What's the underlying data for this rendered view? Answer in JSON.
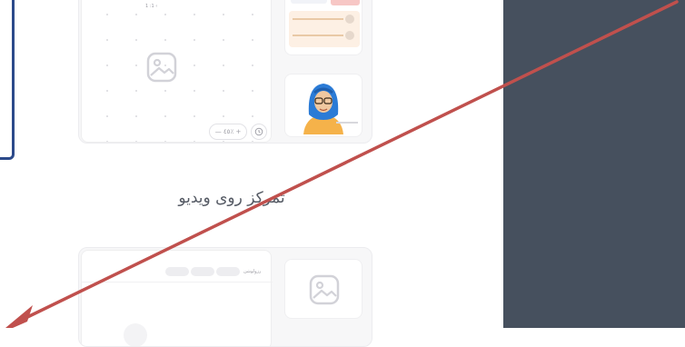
{
  "section_heading": "تمرکز روی ویدیو",
  "top_card": {
    "top_label": "1 :1 ‹",
    "zoom_label": "— ٤٥٪ +",
    "clock_icon": "clock-icon"
  },
  "bottom_card": {
    "header_label": "رزولوشن"
  },
  "colors": {
    "right_pane": "#46505e",
    "frame_border": "#2c4a8a",
    "arrow": "#c0504d",
    "avatar_scarf": "#2b7bd6",
    "avatar_body": "#f5b24a"
  }
}
